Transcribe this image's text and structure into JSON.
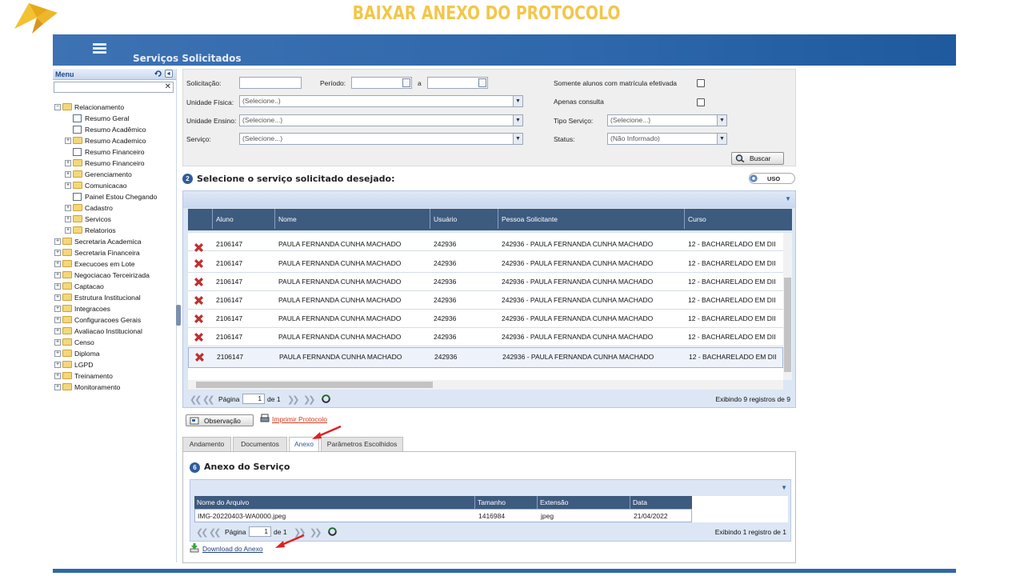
{
  "slide": {
    "title": "BAIXAR ANEXO DO PROTOCOLO"
  },
  "topbar": {
    "page_title": "Serviços Solicitados",
    "menu_icon": "hamburger-icon"
  },
  "sidebar": {
    "header": "Menu",
    "search_placeholder": "",
    "clear_icon": "close-icon",
    "items": [
      {
        "label": "Relacionamento",
        "type": "folder",
        "level": 0,
        "expanded": true
      },
      {
        "label": "Resumo Geral",
        "type": "page",
        "level": 1
      },
      {
        "label": "Resumo Acadêmico",
        "type": "page",
        "level": 1
      },
      {
        "label": "Resumo Academico",
        "type": "folder",
        "level": 1
      },
      {
        "label": "Resumo Financeiro",
        "type": "page",
        "level": 1
      },
      {
        "label": "Resumo Financeiro",
        "type": "folder",
        "level": 1
      },
      {
        "label": "Gerenciamento",
        "type": "folder",
        "level": 1
      },
      {
        "label": "Comunicacao",
        "type": "folder",
        "level": 1
      },
      {
        "label": "Painel Estou Chegando",
        "type": "page",
        "level": 1
      },
      {
        "label": "Cadastro",
        "type": "folder",
        "level": 1
      },
      {
        "label": "Servicos",
        "type": "folder",
        "level": 1
      },
      {
        "label": "Relatorios",
        "type": "folder",
        "level": 1
      },
      {
        "label": "Secretaria Academica",
        "type": "folder",
        "level": 0
      },
      {
        "label": "Secretaria Financeira",
        "type": "folder",
        "level": 0
      },
      {
        "label": "Execucoes em Lote",
        "type": "folder",
        "level": 0
      },
      {
        "label": "Negociacao Terceirizada",
        "type": "folder",
        "level": 0
      },
      {
        "label": "Captacao",
        "type": "folder",
        "level": 0
      },
      {
        "label": "Estrutura Institucional",
        "type": "folder",
        "level": 0
      },
      {
        "label": "Integracoes",
        "type": "folder",
        "level": 0
      },
      {
        "label": "Configuracoes Gerais",
        "type": "folder",
        "level": 0
      },
      {
        "label": "Avaliacao Institucional",
        "type": "folder",
        "level": 0
      },
      {
        "label": "Censo",
        "type": "folder",
        "level": 0
      },
      {
        "label": "Diploma",
        "type": "folder",
        "level": 0
      },
      {
        "label": "LGPD",
        "type": "folder",
        "level": 0
      },
      {
        "label": "Treinamento",
        "type": "folder",
        "level": 0
      },
      {
        "label": "Monitoramento",
        "type": "folder",
        "level": 0
      }
    ]
  },
  "filters": {
    "solicitacao_label": "Solicitação:",
    "solicitacao_value": "",
    "periodo_label": "Período:",
    "periodo_a": "a",
    "somente_label": "Somente alunos com matrícula efetivada",
    "unidade_fisica_label": "Unidade Física:",
    "unidade_fisica_value": "(Selecione..)",
    "apenas_consulta_label": "Apenas consulta",
    "unidade_ensino_label": "Unidade Ensino:",
    "unidade_ensino_value": "(Selecione...)",
    "tipo_servico_label": "Tipo Serviço:",
    "tipo_servico_value": "(Selecione...)",
    "servico_label": "Serviço:",
    "servico_value": "(Selecione...)",
    "status_label": "Status:",
    "status_value": "(Não Informado)",
    "buscar_label": "Buscar"
  },
  "services": {
    "badge": "2",
    "title": "Selecione o serviço solicitado desejado:",
    "toggle_label": "USO",
    "columns": [
      "Aluno",
      "Nome",
      "Usuário",
      "Pessoa Solicitante",
      "Curso"
    ],
    "rows": [
      {
        "aluno": "2106147",
        "nome": "PAULA FERNANDA CUNHA MACHADO",
        "usuario": "242936",
        "solicitante": "242936 - PAULA FERNANDA CUNHA MACHADO",
        "curso": "12 - BACHARELADO EM DII"
      },
      {
        "aluno": "2106147",
        "nome": "PAULA FERNANDA CUNHA MACHADO",
        "usuario": "242936",
        "solicitante": "242936 - PAULA FERNANDA CUNHA MACHADO",
        "curso": "12 - BACHARELADO EM DII"
      },
      {
        "aluno": "2106147",
        "nome": "PAULA FERNANDA CUNHA MACHADO",
        "usuario": "242936",
        "solicitante": "242936 - PAULA FERNANDA CUNHA MACHADO",
        "curso": "12 - BACHARELADO EM DII"
      },
      {
        "aluno": "2106147",
        "nome": "PAULA FERNANDA CUNHA MACHADO",
        "usuario": "242936",
        "solicitante": "242936 - PAULA FERNANDA CUNHA MACHADO",
        "curso": "12 - BACHARELADO EM DII"
      },
      {
        "aluno": "2106147",
        "nome": "PAULA FERNANDA CUNHA MACHADO",
        "usuario": "242936",
        "solicitante": "242936 - PAULA FERNANDA CUNHA MACHADO",
        "curso": "12 - BACHARELADO EM DII"
      },
      {
        "aluno": "2106147",
        "nome": "PAULA FERNANDA CUNHA MACHADO",
        "usuario": "242936",
        "solicitante": "242936 - PAULA FERNANDA CUNHA MACHADO",
        "curso": "12 - BACHARELADO EM DII"
      },
      {
        "aluno": "2106147",
        "nome": "PAULA FERNANDA CUNHA MACHADO",
        "usuario": "242936",
        "solicitante": "242936 - PAULA FERNANDA CUNHA MACHADO",
        "curso": "12 - BACHARELADO EM DII"
      }
    ],
    "pager": {
      "pagina_label": "Página",
      "page": "1",
      "de_label": "de 1",
      "summary": "Exibindo 9 registros de 9"
    }
  },
  "actions": {
    "observacao_label": "Observação",
    "imprimir_label": "Imprimir Protocolo"
  },
  "tabs": [
    "Andamento",
    "Documentos",
    "Anexo",
    "Parâmetros Escolhidos"
  ],
  "anexo": {
    "badge": "6",
    "title": "Anexo do Serviço",
    "columns": [
      "Nome do Arquivo",
      "Tamanho",
      "Extensão",
      "Data"
    ],
    "row": {
      "nome": "IMG-20220403-WA0000.jpeg",
      "tamanho": "1416984",
      "extensao": "jpeg",
      "data": "21/04/2022"
    },
    "pager": {
      "pagina_label": "Página",
      "page": "1",
      "de_label": "de 1",
      "summary": "Exibindo 1 registro de 1"
    },
    "download_label": "Download do Anexo"
  },
  "colors": {
    "accent": "#2e67ab",
    "title_gold": "#f3c64a",
    "header_dark": "#3d5a7f",
    "annotation_red": "#e02020"
  }
}
